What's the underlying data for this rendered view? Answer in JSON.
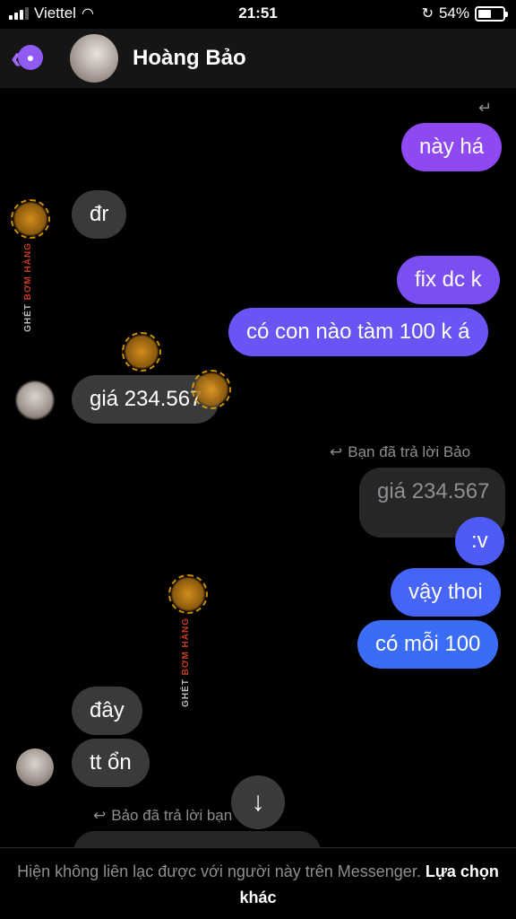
{
  "status_bar": {
    "carrier": "Viettel",
    "time": "21:51",
    "battery": "54%",
    "battery_level": 0.54
  },
  "header": {
    "contact_name": "Hoàng Bảo"
  },
  "messages": [
    {
      "side": "out",
      "text": "này há"
    },
    {
      "side": "in",
      "text": "đr"
    },
    {
      "side": "out",
      "text": "fix dc k"
    },
    {
      "side": "out",
      "text": "có con nào tàm 100 k á"
    },
    {
      "side": "in",
      "text": "giá 234.567"
    },
    {
      "side": "out",
      "text": "giá 234.567",
      "quoted": true
    },
    {
      "side": "out",
      "text": ":v"
    },
    {
      "side": "out",
      "text": "vậy thoi"
    },
    {
      "side": "out",
      "text": "có mỗi 100"
    },
    {
      "side": "in",
      "text": "đây"
    },
    {
      "side": "in",
      "text": "tt ổn"
    }
  ],
  "reply_notes": {
    "you_replied": "Bạn đã trả lời Bảo",
    "bao_replied": "Bảo đã trả lời bạn"
  },
  "watermark": {
    "line1": "GHÉT",
    "line2": "BƠM HÀNG"
  },
  "footer": {
    "text": "Hiện không liên lạc được với người này trên Messenger.",
    "link": "Lựa chọn khác"
  },
  "colors": {
    "bubble_purple": "#8f49f2",
    "bubble_blue": "#3b6cf5",
    "bubble_gray": "#3a3a3c"
  }
}
